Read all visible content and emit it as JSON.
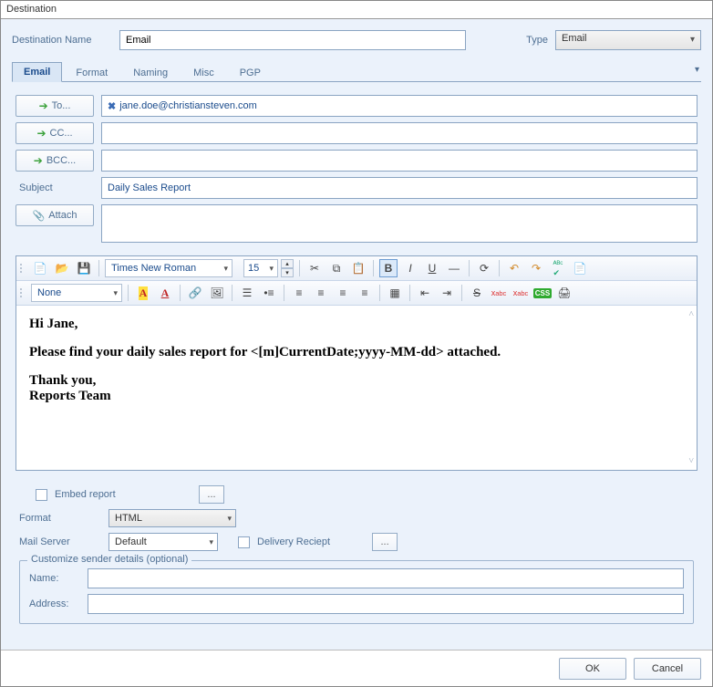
{
  "window": {
    "title": "Destination"
  },
  "header": {
    "destNameLabel": "Destination Name",
    "destNameValue": "Email",
    "typeLabel": "Type",
    "typeValue": "Email"
  },
  "tabs": {
    "items": [
      {
        "label": "Email",
        "active": true
      },
      {
        "label": "Format",
        "active": false
      },
      {
        "label": "Naming",
        "active": false
      },
      {
        "label": "Misc",
        "active": false
      },
      {
        "label": "PGP",
        "active": false
      }
    ]
  },
  "email": {
    "toLabel": "To...",
    "toValue": "jane.doe@christiansteven.com",
    "ccLabel": "CC...",
    "ccValue": "",
    "bccLabel": "BCC...",
    "bccValue": "",
    "subjectLabel": "Subject",
    "subjectValue": "Daily Sales Report",
    "attachLabel": "Attach",
    "attachValue": ""
  },
  "editor": {
    "fontName": "Times New Roman",
    "fontSize": "15",
    "styleSelect": "None",
    "body": {
      "line1": "Hi Jane,",
      "line2": "Please find your daily sales report for <[m]CurrentDate;yyyy-MM-dd> attached.",
      "line3": "Thank you,",
      "line4": "Reports Team"
    }
  },
  "options": {
    "embedLabel": "Embed report",
    "formatLabel": "Format",
    "formatValue": "HTML",
    "mailServerLabel": "Mail Server",
    "mailServerValue": "Default",
    "deliveryReceiptLabel": "Delivery Reciept",
    "senderLegend": "Customize sender details (optional)",
    "nameLabel": "Name:",
    "nameValue": "",
    "addressLabel": "Address:",
    "addressValue": ""
  },
  "footer": {
    "ok": "OK",
    "cancel": "Cancel"
  }
}
